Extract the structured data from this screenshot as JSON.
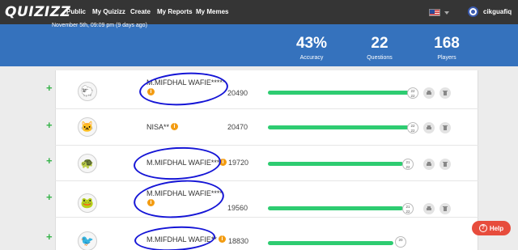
{
  "nav": {
    "logo": "QUIZIZZ",
    "items": [
      "Public",
      "My Quizizz",
      "Create",
      "My Reports",
      "My Memes"
    ],
    "username": "cikguafiq",
    "flag_icon": "us-flag-icon"
  },
  "header": {
    "date": "November 5th, 09:09 pm (9 days ago)",
    "stats": [
      {
        "value": "43%",
        "label": "Accuracy"
      },
      {
        "value": "22",
        "label": "Questions"
      },
      {
        "value": "168",
        "label": "Players"
      }
    ]
  },
  "players": [
    {
      "name": "M.MIFDHAL WAFIE*****",
      "score": "20490",
      "badge": "22/22",
      "progress": 0.98,
      "avatar": "sheep-avatar-icon"
    },
    {
      "name": "NISA**",
      "score": "20470",
      "badge": "22/22",
      "progress": 0.98,
      "avatar": "cat-avatar-icon"
    },
    {
      "name": "M.MIFDHAL WAFIE***",
      "score": "19720",
      "badge": "21/22",
      "progress": 0.94,
      "avatar": "turtle-avatar-icon"
    },
    {
      "name": "M.MIFDHAL WAFIE****",
      "score": "19560",
      "badge": "21/22",
      "progress": 0.94,
      "avatar": "frog-avatar-icon"
    },
    {
      "name": "M.MIFDHAL WAFIE**",
      "score": "18830",
      "badge": "20",
      "progress": 0.86,
      "avatar": "bird-avatar-icon"
    }
  ],
  "help": {
    "label": "Help"
  },
  "colors": {
    "nav": "#353535",
    "banner": "#3572bd",
    "progress": "#2ecc71",
    "help": "#e74c3c",
    "annotation": "#1515d6"
  }
}
